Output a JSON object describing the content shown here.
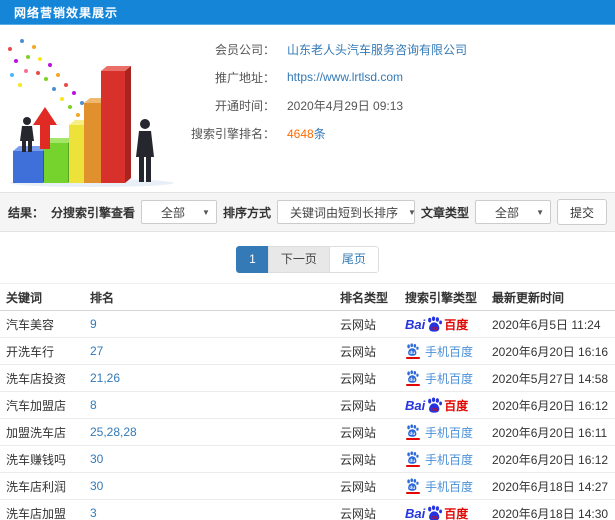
{
  "header": {
    "title": "网络营销效果展示"
  },
  "colors": {
    "topbar_blue": "#1585d8",
    "link_blue": "#337ab7",
    "highlight_orange": "#ff6a00",
    "baidu_blue": "#2534dd",
    "baidu_red": "#e10601"
  },
  "info": {
    "illustration": "growth-bar-chart-with-businessmen-illustration",
    "fields": [
      {
        "label": "会员公司：",
        "value": "山东老人头汽车服务咨询有限公司"
      },
      {
        "label": "推广地址：",
        "value": "https://www.lrtlsd.com"
      },
      {
        "label": "开通时间：",
        "value": "2020年4月29日 09:13"
      },
      {
        "label": "搜索引擎排名：",
        "count": "4648",
        "unit": "条"
      }
    ]
  },
  "filters": {
    "result_label": "结果：",
    "engine_label": "分搜索引擎查看",
    "engine_value": "全部",
    "sort_label": "排序方式",
    "sort_value": "关键词由短到长排序",
    "article_label": "文章类型",
    "article_value": "全部",
    "submit_label": "提交"
  },
  "pagination": {
    "current": "1",
    "next": "下一页",
    "last": "尾页"
  },
  "table": {
    "headers": [
      "关键词",
      "排名",
      "排名类型",
      "搜索引擎类型",
      "最新更新时间"
    ],
    "engine_logos": {
      "baidu": {
        "bai": "Bai",
        "du": "du",
        "cn": "百度"
      },
      "mobile": {
        "du": "du",
        "label": "手机百度"
      }
    },
    "rows": [
      {
        "keyword": "汽车美容",
        "rank": "9",
        "rank_type": "云网站",
        "engine": "baidu-logo",
        "updated": "2020年6月5日 11:24"
      },
      {
        "keyword": "开洗车行",
        "rank": "27",
        "rank_type": "云网站",
        "engine": "mobile-baidu-icon",
        "updated": "2020年6月20日 16:16"
      },
      {
        "keyword": "洗车店投资",
        "rank": "21,26",
        "rank_type": "云网站",
        "engine": "mobile-baidu-icon",
        "updated": "2020年5月27日 14:58"
      },
      {
        "keyword": "汽车加盟店",
        "rank": "8",
        "rank_type": "云网站",
        "engine": "baidu-logo",
        "updated": "2020年6月20日 16:12"
      },
      {
        "keyword": "加盟洗车店",
        "rank": "25,28,28",
        "rank_type": "云网站",
        "engine": "mobile-baidu-icon",
        "updated": "2020年6月20日 16:11"
      },
      {
        "keyword": "洗车赚钱吗",
        "rank": "30",
        "rank_type": "云网站",
        "engine": "mobile-baidu-icon",
        "updated": "2020年6月20日 16:12"
      },
      {
        "keyword": "洗车店利润",
        "rank": "30",
        "rank_type": "云网站",
        "engine": "mobile-baidu-icon",
        "updated": "2020年6月18日 14:27"
      },
      {
        "keyword": "洗车店加盟",
        "rank": "3",
        "rank_type": "云网站",
        "engine": "baidu-logo",
        "updated": "2020年6月18日 14:30"
      }
    ]
  }
}
